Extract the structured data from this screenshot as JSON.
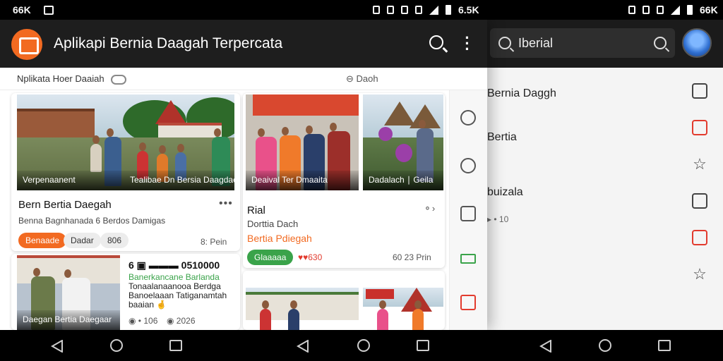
{
  "status": {
    "left_text": "66K",
    "mid_text": "6.5K",
    "right_text": "66K"
  },
  "app": {
    "title": "Aplikapi Bernia Daagah Terpercata",
    "breadcrumb": "Nplikata Hoer Daaiah",
    "sub_link": "⊖ Daoh"
  },
  "right_panel": {
    "search_value": "Iberial",
    "items": [
      "Bernia Daggh",
      "Bertia",
      "buizala",
      "▸ • 10"
    ]
  },
  "cards": {
    "top_left": {
      "caption_left": "Verpenaanent",
      "caption_right": "Tealibae Dn Bersia Daagdae",
      "title": "Bern Bertia Daegah",
      "sub": "Benna Bagnhanada 6 Berdos Damigas",
      "chips": [
        "Benaade",
        "Dadar",
        "806"
      ],
      "meta": "8: Pein"
    },
    "top_right": {
      "caption_left": "Deaival Ter Dmaaita",
      "caption_right": "Dadalach ∣ Geila",
      "title": "Rial",
      "sub": "Dorttia Dach",
      "highlight": "Bertia Pdiegah",
      "chip": "Glaaaaa",
      "stat": "♥♥630",
      "meta": "60 23 Prin"
    },
    "bottom_left": {
      "caption": "Daegan Bertia Daegaar",
      "headline": "6 ▣ ▬▬▬ 0510000",
      "green_line": "Banerkancane Barlanda",
      "body": "Tonaalanaanooa Berdga Banoelaaan Tatiganamtah baaian 🤞",
      "meta_left": "◉ • 106",
      "meta_right": "◉ 2026"
    }
  },
  "nav": {
    "back": "back",
    "home": "home",
    "recent": "recent"
  },
  "colors": {
    "accent_orange": "#f26a21",
    "accent_green": "#3aa34a",
    "accent_red": "#e23b2e",
    "app_bar": "#1e1e1e"
  }
}
